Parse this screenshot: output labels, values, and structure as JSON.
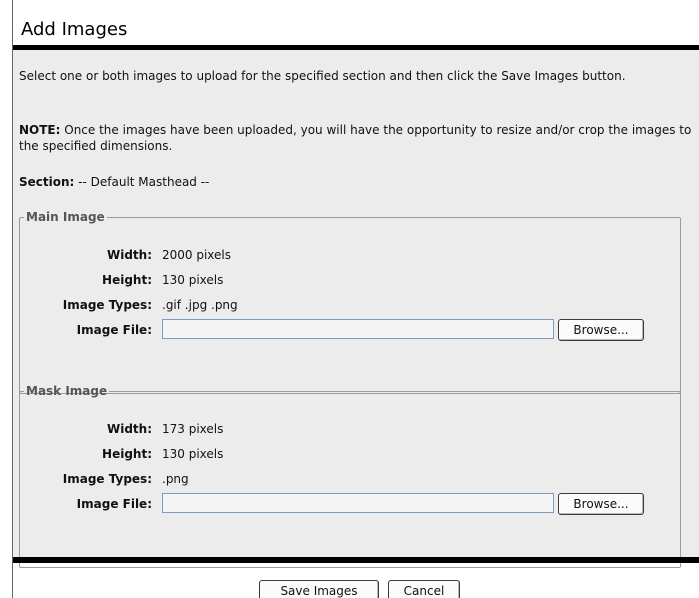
{
  "dialog": {
    "title": "Add Images",
    "intro": "Select one or both images to upload for the specified section and then click the Save Images button.",
    "note_label": "NOTE:",
    "note_text": " Once the images have been uploaded, you will have the opportunity to resize and/or crop the images to the specified dimensions.",
    "section_label": "Section:",
    "section_value": " -- Default Masthead --"
  },
  "main_image": {
    "legend": "Main Image",
    "width_label": "Width:",
    "width_value": "2000 pixels",
    "height_label": "Height:",
    "height_value": "130 pixels",
    "types_label": "Image Types:",
    "types_value": ".gif .jpg .png",
    "file_label": "Image File:",
    "file_value": "",
    "browse_label": "Browse..."
  },
  "mask_image": {
    "legend": "Mask Image",
    "width_label": "Width:",
    "width_value": "173 pixels",
    "height_label": "Height:",
    "height_value": "130 pixels",
    "types_label": "Image Types:",
    "types_value": ".png",
    "file_label": "Image File:",
    "file_value": "",
    "browse_label": "Browse..."
  },
  "actions": {
    "save_label": "Save Images",
    "cancel_label": "Cancel"
  }
}
